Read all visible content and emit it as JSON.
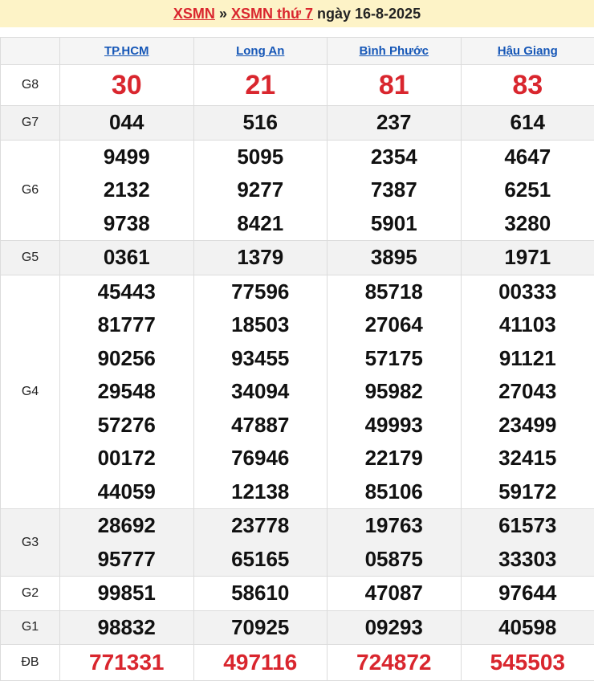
{
  "header": {
    "link1": "XSMN",
    "separator": "»",
    "link2": "XSMN thứ 7",
    "date": "ngày 16-8-2025"
  },
  "provinces": [
    "TP.HCM",
    "Long An",
    "Bình Phước",
    "Hậu Giang"
  ],
  "prizes": [
    {
      "label": "G8",
      "key": "g8",
      "shade": false,
      "values": [
        [
          "30"
        ],
        [
          "21"
        ],
        [
          "81"
        ],
        [
          "83"
        ]
      ]
    },
    {
      "label": "G7",
      "key": "g7",
      "shade": true,
      "values": [
        [
          "044"
        ],
        [
          "516"
        ],
        [
          "237"
        ],
        [
          "614"
        ]
      ]
    },
    {
      "label": "G6",
      "key": "g6",
      "shade": false,
      "values": [
        [
          "9499",
          "2132",
          "9738"
        ],
        [
          "5095",
          "9277",
          "8421"
        ],
        [
          "2354",
          "7387",
          "5901"
        ],
        [
          "4647",
          "6251",
          "3280"
        ]
      ]
    },
    {
      "label": "G5",
      "key": "g5",
      "shade": true,
      "values": [
        [
          "0361"
        ],
        [
          "1379"
        ],
        [
          "3895"
        ],
        [
          "1971"
        ]
      ]
    },
    {
      "label": "G4",
      "key": "g4",
      "shade": false,
      "values": [
        [
          "45443",
          "81777",
          "90256",
          "29548",
          "57276",
          "00172",
          "44059"
        ],
        [
          "77596",
          "18503",
          "93455",
          "34094",
          "47887",
          "76946",
          "12138"
        ],
        [
          "85718",
          "27064",
          "57175",
          "95982",
          "49993",
          "22179",
          "85106"
        ],
        [
          "00333",
          "41103",
          "91121",
          "27043",
          "23499",
          "32415",
          "59172"
        ]
      ]
    },
    {
      "label": "G3",
      "key": "g3",
      "shade": true,
      "values": [
        [
          "28692",
          "95777"
        ],
        [
          "23778",
          "65165"
        ],
        [
          "19763",
          "05875"
        ],
        [
          "61573",
          "33303"
        ]
      ]
    },
    {
      "label": "G2",
      "key": "g2",
      "shade": false,
      "values": [
        [
          "99851"
        ],
        [
          "58610"
        ],
        [
          "47087"
        ],
        [
          "97644"
        ]
      ]
    },
    {
      "label": "G1",
      "key": "g1",
      "shade": true,
      "values": [
        [
          "98832"
        ],
        [
          "70925"
        ],
        [
          "09293"
        ],
        [
          "40598"
        ]
      ]
    },
    {
      "label": "ĐB",
      "key": "db",
      "shade": false,
      "values": [
        [
          "771331"
        ],
        [
          "497116"
        ],
        [
          "724872"
        ],
        [
          "545503"
        ]
      ]
    }
  ]
}
